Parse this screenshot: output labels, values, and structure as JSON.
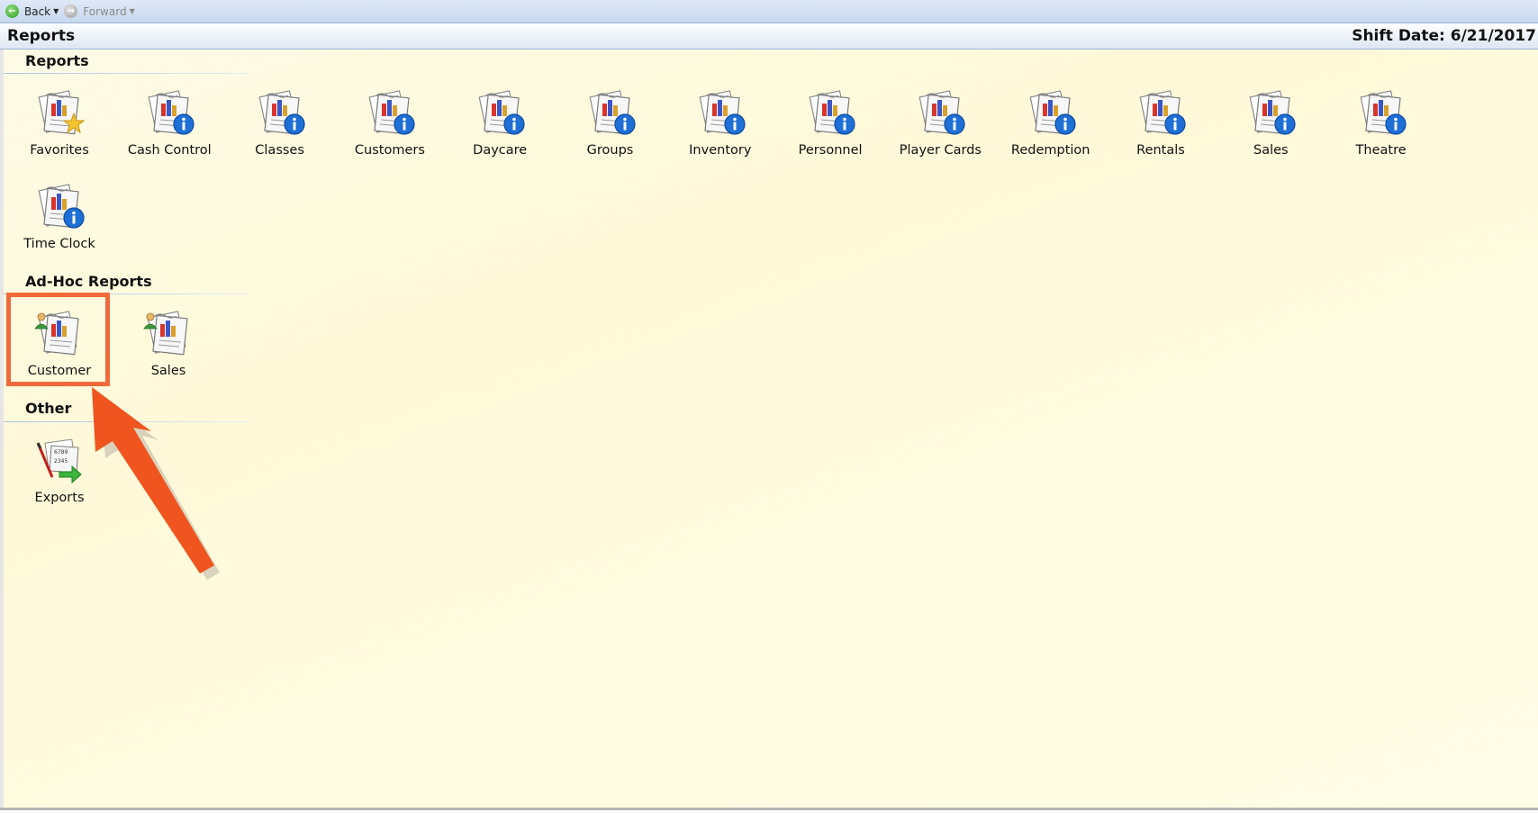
{
  "nav": {
    "back_label": "Back",
    "forward_label": "Forward"
  },
  "title": {
    "left": "Reports",
    "right": "Shift Date: 6/21/2017"
  },
  "sections": {
    "reports": {
      "header": "Reports",
      "items": [
        "Favorites",
        "Cash Control",
        "Classes",
        "Customers",
        "Daycare",
        "Groups",
        "Inventory",
        "Personnel",
        "Player Cards",
        "Redemption",
        "Rentals",
        "Sales",
        "Theatre",
        "Time Clock"
      ]
    },
    "adhoc": {
      "header": "Ad-Hoc Reports",
      "items": [
        "Customer",
        "Sales"
      ]
    },
    "other": {
      "header": "Other",
      "items": [
        "Exports"
      ]
    }
  },
  "colors": {
    "highlight": "#ef6a3a",
    "info_badge": "#1e6fd6",
    "accent_star": "#f4c430"
  },
  "icons": {
    "favorites": "report-star-icon",
    "info": "report-info-icon",
    "adhoc": "report-person-icon",
    "export": "export-arrow-icon"
  }
}
